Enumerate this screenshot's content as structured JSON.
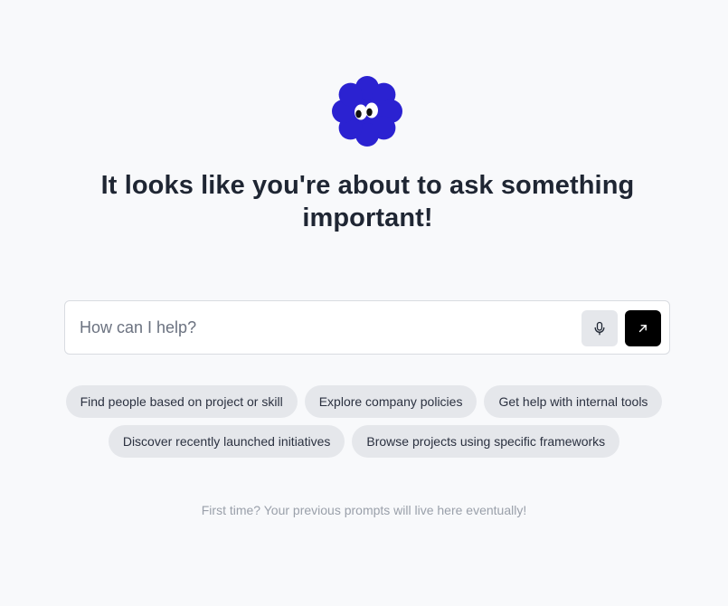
{
  "hero": {
    "mascot_icon": "flower-mascot-icon",
    "mascot_color": "#2b22d1",
    "headline": "It looks like you're about to ask something important!"
  },
  "prompt": {
    "placeholder": "How can I help?",
    "value": "",
    "mic_icon": "microphone-icon",
    "send_icon": "arrow-up-right-icon"
  },
  "suggestions": {
    "row1": [
      "Find people based on project or skill",
      "Explore company policies",
      "Get help with internal tools"
    ],
    "row2": [
      "Discover recently launched initiatives",
      "Browse projects using specific frameworks"
    ]
  },
  "history": {
    "empty_text": "First time? Your previous prompts will live here eventually!"
  }
}
